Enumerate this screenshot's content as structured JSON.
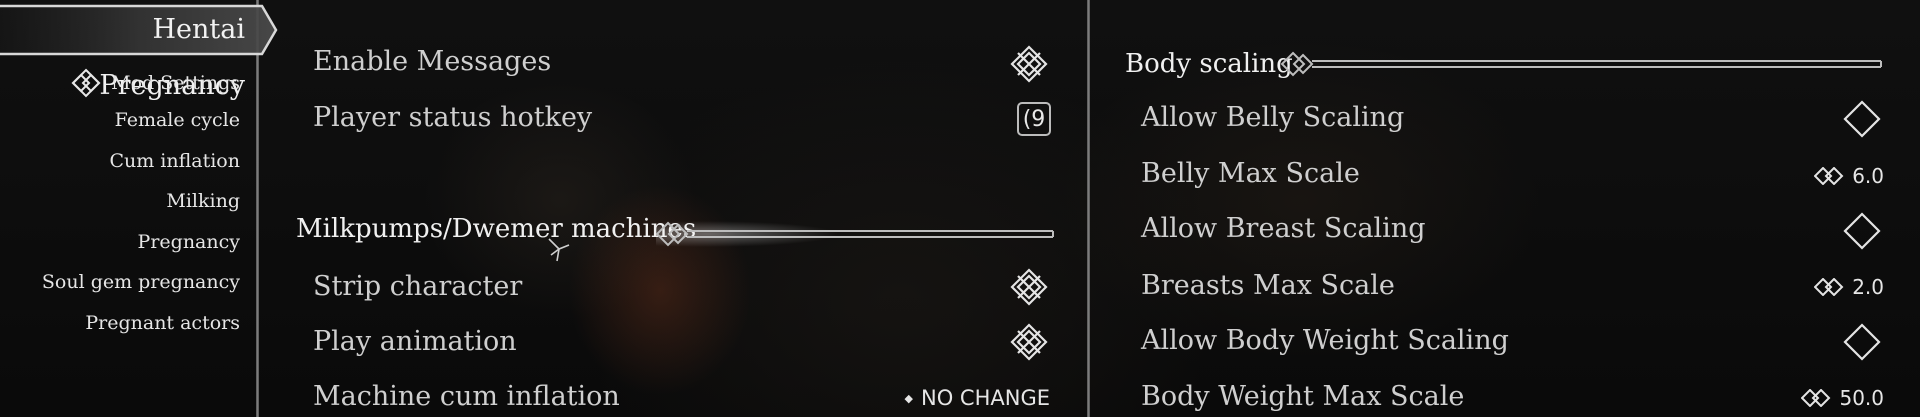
{
  "sidebar": {
    "title": "Hentai Pregnancy",
    "items": [
      {
        "label": "Mod Settings",
        "icon": "diamond-knot-icon",
        "selected": true
      },
      {
        "label": "Female cycle"
      },
      {
        "label": "Cum inflation"
      },
      {
        "label": "Milking"
      },
      {
        "label": "Pregnancy"
      },
      {
        "label": "Soul gem pregnancy"
      },
      {
        "label": "Pregnant actors"
      }
    ]
  },
  "left_column": {
    "rows_top": [
      {
        "label": "Enable Messages",
        "control": "checkbox",
        "checked": true
      },
      {
        "label": "Player status hotkey",
        "control": "hotkey",
        "key": "(9"
      }
    ],
    "section_header": "Milkpumps/Dwemer machines",
    "rows": [
      {
        "label": "Strip character",
        "control": "checkbox",
        "checked": true
      },
      {
        "label": "Play animation",
        "control": "checkbox",
        "checked": true
      },
      {
        "label": "Machine cum inflation",
        "control": "menu",
        "value": "NO CHANGE"
      }
    ]
  },
  "right_column": {
    "section_header": "Body scaling",
    "rows": [
      {
        "label": "Allow Belly Scaling",
        "control": "checkbox",
        "checked": false
      },
      {
        "label": "Belly Max Scale",
        "control": "slider",
        "value": "6.0"
      },
      {
        "label": "Allow Breast Scaling",
        "control": "checkbox",
        "checked": false
      },
      {
        "label": "Breasts Max Scale",
        "control": "slider",
        "value": "2.0"
      },
      {
        "label": "Allow Body Weight Scaling",
        "control": "checkbox",
        "checked": false
      },
      {
        "label": "Body Weight Max Scale",
        "control": "slider",
        "value": "50.0"
      }
    ]
  },
  "colors": {
    "text": "#cfcfcf",
    "header_text": "#f0f0f0",
    "ornament": "#b8b8b8",
    "background": "#0c0c0c"
  }
}
